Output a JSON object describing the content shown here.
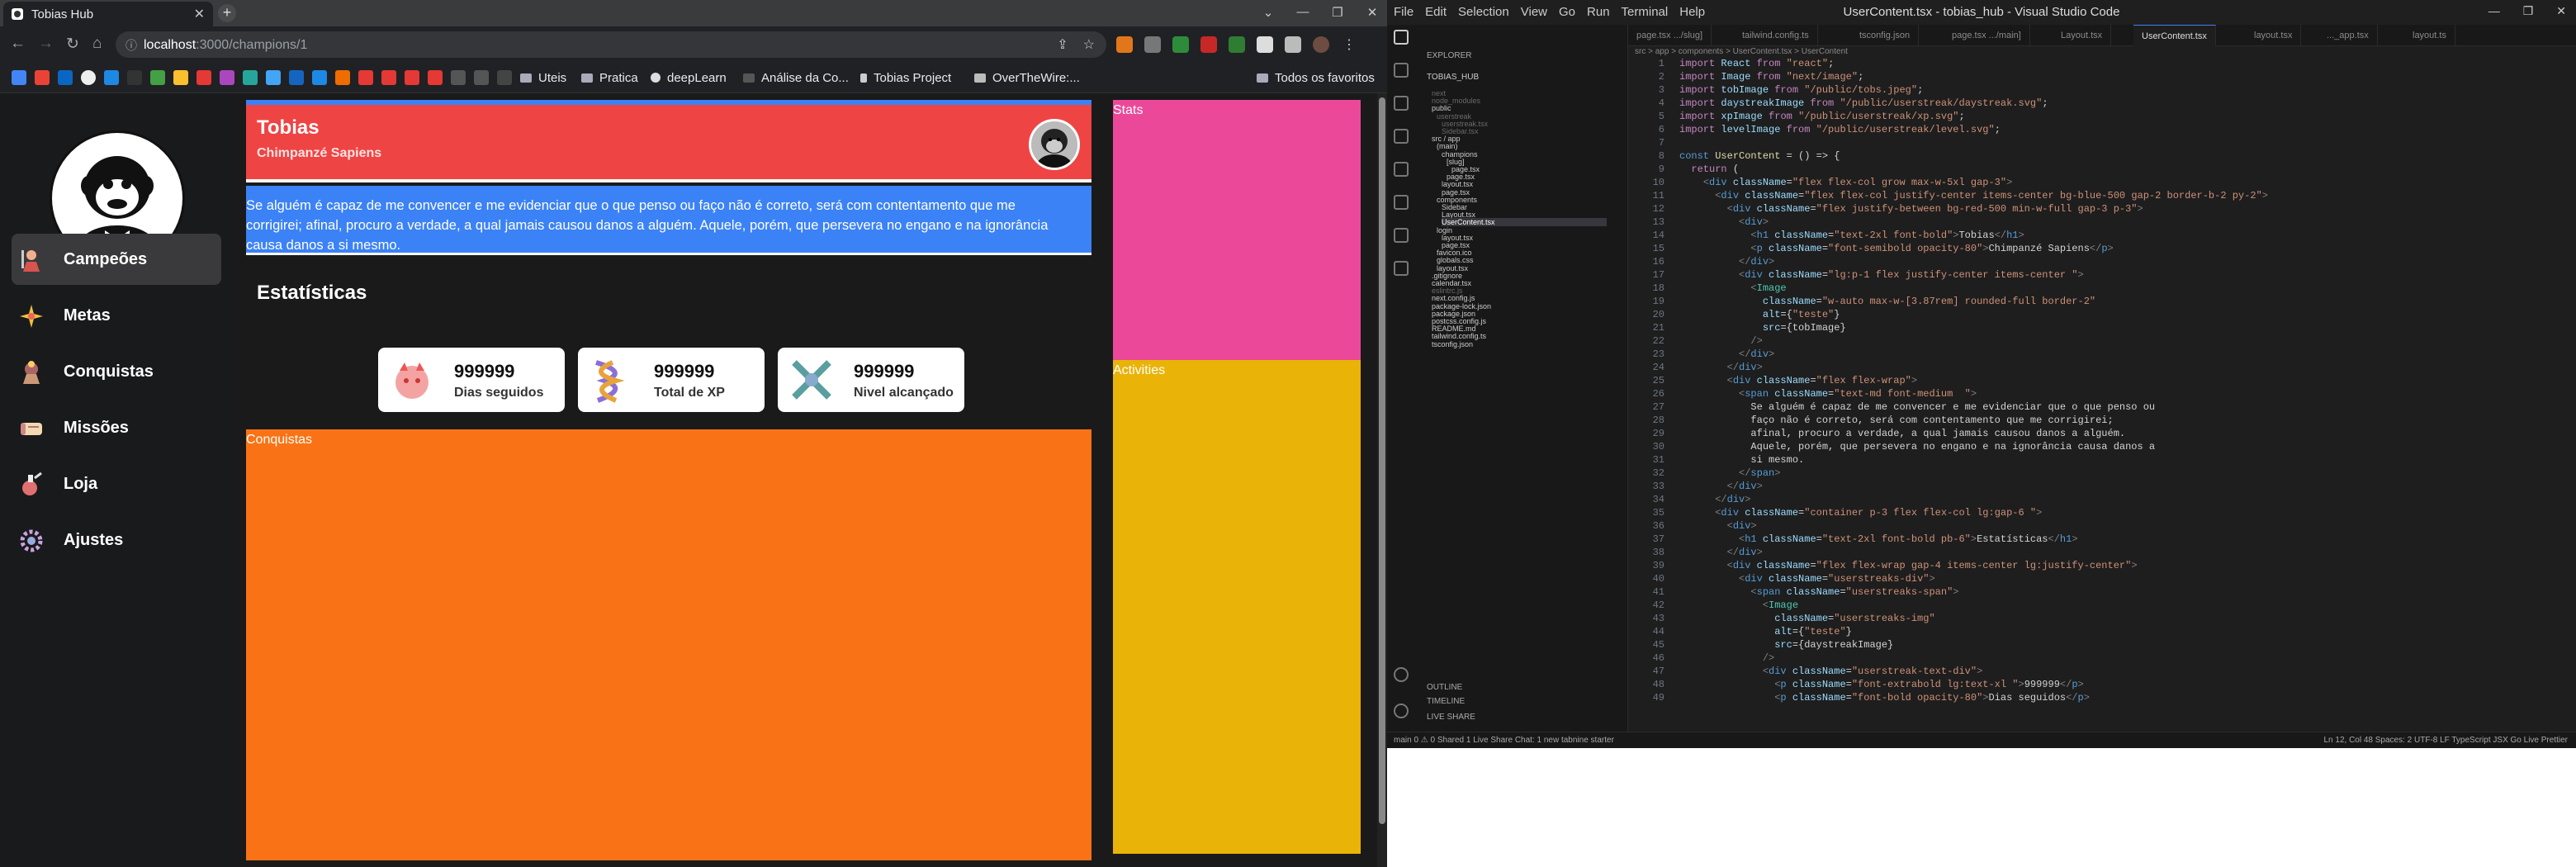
{
  "browser": {
    "tab_title": "Tobias Hub",
    "tab_close": "✕",
    "new_tab": "+",
    "url_host": "localhost",
    "url_path": ":3000/champions/1",
    "bookmarks": [
      {
        "label": "Uteis"
      },
      {
        "label": "Pratica"
      },
      {
        "label": "deepLearn"
      },
      {
        "label": "Análise da Co..."
      },
      {
        "label": "Tobias Project"
      },
      {
        "label": "OverTheWire:..."
      },
      {
        "label": "Todos os favoritos"
      }
    ]
  },
  "app": {
    "nav": [
      {
        "label": "Campeões",
        "icon": "warrior-icon"
      },
      {
        "label": "Metas",
        "icon": "target-icon"
      },
      {
        "label": "Conquistas",
        "icon": "trophy-icon"
      },
      {
        "label": "Missões",
        "icon": "scroll-icon"
      },
      {
        "label": "Loja",
        "icon": "potion-icon"
      },
      {
        "label": "Ajustes",
        "icon": "gear-icon"
      }
    ],
    "user": {
      "name": "Tobias",
      "species": "Chimpanzé Sapiens"
    },
    "quote": {
      "line1": "Se alguém é capaz de me convencer e me evidenciar que o que penso ou faço não é correto, será com contentamento que me",
      "line2": "corrigirei; afinal, procuro a verdade, a qual jamais causou danos a alguém. Aquele, porém, que persevera no engano e na ignorância",
      "line3": "causa danos a si mesmo."
    },
    "stats_title": "Estatísticas",
    "stat_cards": [
      {
        "value": "999999",
        "label": "Dias seguidos"
      },
      {
        "value": "999999",
        "label": "Total de XP"
      },
      {
        "value": "999999",
        "label": "Nivel alcançado"
      }
    ],
    "conquistas_label": "Conquistas",
    "stats_label": "Stats",
    "activities_label": "Activities"
  },
  "vscode": {
    "window_title": "UserContent.tsx - tobias_hub - Visual Studio Code",
    "menu": [
      "File",
      "Edit",
      "Selection",
      "View",
      "Go",
      "Run",
      "Terminal",
      "Help"
    ],
    "explorer_title": "EXPLORER",
    "project": "TOBIAS_HUB",
    "tree": [
      {
        "label": "next",
        "color": "#6a6a6a"
      },
      {
        "label": "node_modules",
        "color": "#6a6a6a"
      },
      {
        "label": "public",
        "color": "#cccccc"
      },
      {
        "label": "userstreak",
        "color": "#6a6a6a"
      },
      {
        "label": "userstreak.tsx",
        "color": "#6a6a6a"
      },
      {
        "label": "Sidebar.tsx",
        "color": "#6a6a6a"
      },
      {
        "label": "src / app",
        "color": "#cccccc"
      },
      {
        "label": "(main)",
        "color": "#cccccc"
      },
      {
        "label": "champions",
        "color": "#cccccc"
      },
      {
        "label": "[slug]",
        "color": "#cccccc"
      },
      {
        "label": "page.tsx",
        "color": "#cccccc"
      },
      {
        "label": "page.tsx",
        "color": "#cccccc"
      },
      {
        "label": "layout.tsx",
        "color": "#cccccc"
      },
      {
        "label": "page.tsx",
        "color": "#cccccc"
      },
      {
        "label": "components",
        "color": "#cccccc"
      },
      {
        "label": "Sidebar",
        "color": "#cccccc"
      },
      {
        "label": "Layout.tsx",
        "color": "#cccccc"
      },
      {
        "label": "UserContent.tsx",
        "color": "#ffffff"
      },
      {
        "label": "login",
        "color": "#cccccc"
      },
      {
        "label": "layout.tsx",
        "color": "#cccccc"
      },
      {
        "label": "page.tsx",
        "color": "#cccccc"
      },
      {
        "label": "favicon.ico",
        "color": "#cccccc"
      },
      {
        "label": "globals.css",
        "color": "#cccccc"
      },
      {
        "label": "layout.tsx",
        "color": "#cccccc"
      },
      {
        "label": ".gitignore",
        "color": "#cccccc"
      },
      {
        "label": "calendar.tsx",
        "color": "#cccccc"
      },
      {
        "label": "eslintrc.js",
        "color": "#6a6a6a"
      },
      {
        "label": "next.config.js",
        "color": "#cccccc"
      },
      {
        "label": "package-lock.json",
        "color": "#cccccc"
      },
      {
        "label": "package.json",
        "color": "#cccccc"
      },
      {
        "label": "postcss.config.js",
        "color": "#cccccc"
      },
      {
        "label": "README.md",
        "color": "#cccccc"
      },
      {
        "label": "tailwind.config.ts",
        "color": "#cccccc"
      },
      {
        "label": "tsconfig.json",
        "color": "#cccccc"
      }
    ],
    "outline": "OUTLINE",
    "timeline": "TIMELINE",
    "liveshare": "LIVE SHARE",
    "tabs": [
      {
        "label": "page.tsx .../slug]"
      },
      {
        "label": "tailwind.config.ts"
      },
      {
        "label": "tsconfig.json"
      },
      {
        "label": "page.tsx .../main]"
      },
      {
        "label": "Layout.tsx"
      },
      {
        "label": "UserContent.tsx"
      },
      {
        "label": "layout.tsx"
      },
      {
        "label": "..._app.tsx"
      },
      {
        "label": "layout.ts"
      }
    ],
    "breadcrumb": "src > app > components > UserContent.tsx > UserContent",
    "status_left": "main   0 ⚠ 0   Shared   1   Live Share Chat: 1 new   tabnine starter",
    "status_right": "Ln 12, Col 48   Spaces: 2   UTF-8   LF   TypeScript JSX   Go Live   Prettier"
  }
}
